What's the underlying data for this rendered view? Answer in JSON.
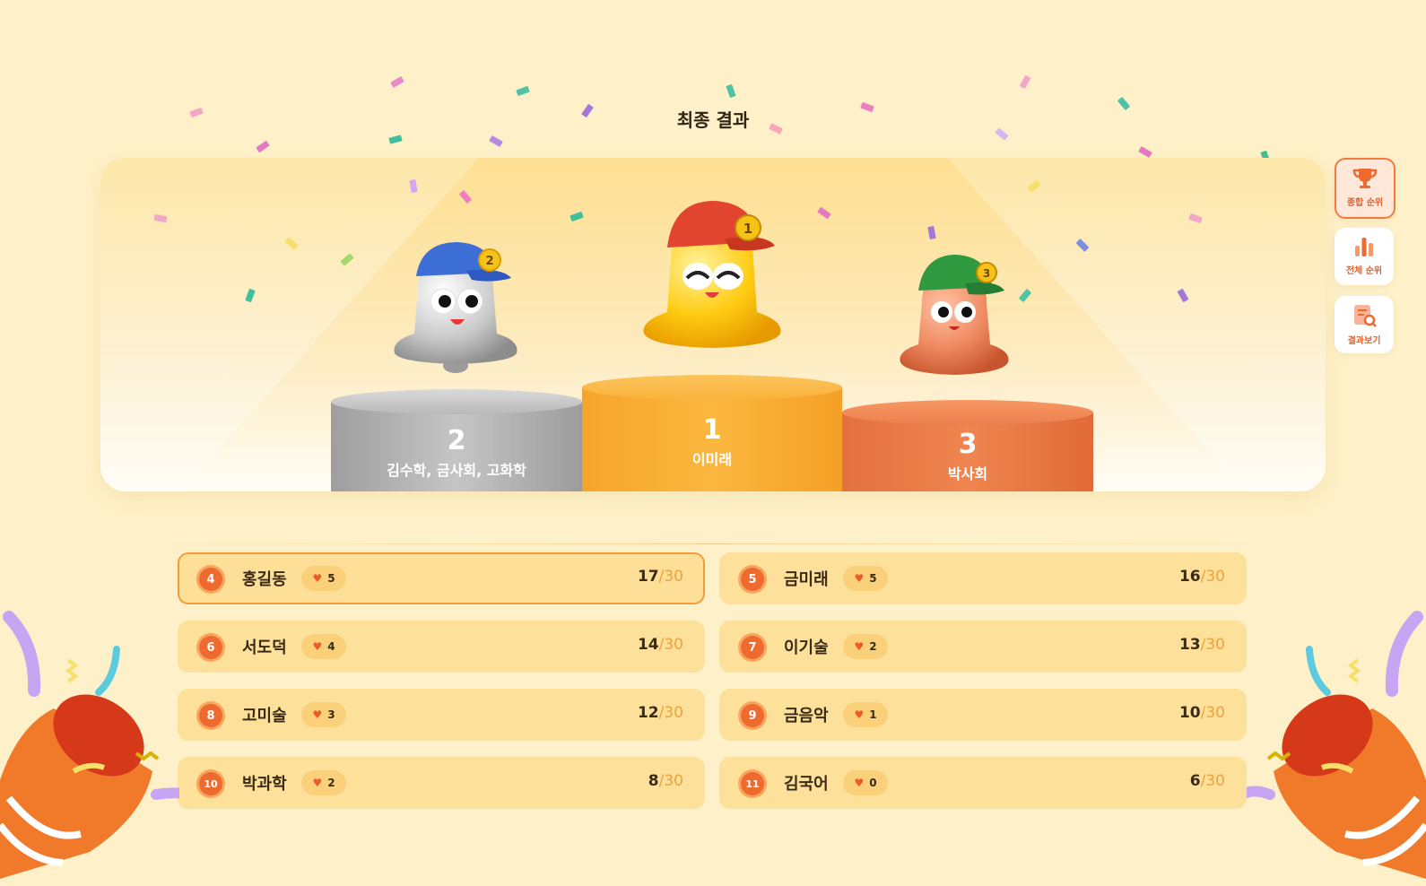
{
  "page": {
    "title": "최종 결과"
  },
  "podium": [
    {
      "place": "2",
      "names": "김수학, 금사회, 고화학",
      "cap_number": "2"
    },
    {
      "place": "1",
      "names": "이미래",
      "cap_number": "1"
    },
    {
      "place": "3",
      "names": "박사회",
      "cap_number": "3"
    }
  ],
  "side_menu": [
    {
      "label": "종합 순위",
      "icon": "trophy-icon",
      "active": true
    },
    {
      "label": "전체 순위",
      "icon": "bar-chart-icon",
      "active": false
    },
    {
      "label": "결과보기",
      "icon": "document-search-icon",
      "active": false
    }
  ],
  "rankings": [
    {
      "rank": "4",
      "name": "홍길동",
      "hearts": "5",
      "score": "17",
      "total": "/30",
      "highlight": true
    },
    {
      "rank": "5",
      "name": "금미래",
      "hearts": "5",
      "score": "16",
      "total": "/30"
    },
    {
      "rank": "6",
      "name": "서도덕",
      "hearts": "4",
      "score": "14",
      "total": "/30"
    },
    {
      "rank": "7",
      "name": "이기술",
      "hearts": "2",
      "score": "13",
      "total": "/30"
    },
    {
      "rank": "8",
      "name": "고미술",
      "hearts": "3",
      "score": "12",
      "total": "/30"
    },
    {
      "rank": "9",
      "name": "금음악",
      "hearts": "1",
      "score": "10",
      "total": "/30"
    },
    {
      "rank": "10",
      "name": "박과학",
      "hearts": "2",
      "score": "8",
      "total": "/30"
    },
    {
      "rank": "11",
      "name": "김국어",
      "hearts": "0",
      "score": "6",
      "total": "/30"
    }
  ],
  "colors": {
    "accent": "#ef6a2e",
    "gold": "#fbb73f",
    "silver": "#bdbdbd",
    "bronze": "#ec7f4d",
    "background": "#fef1c9"
  }
}
